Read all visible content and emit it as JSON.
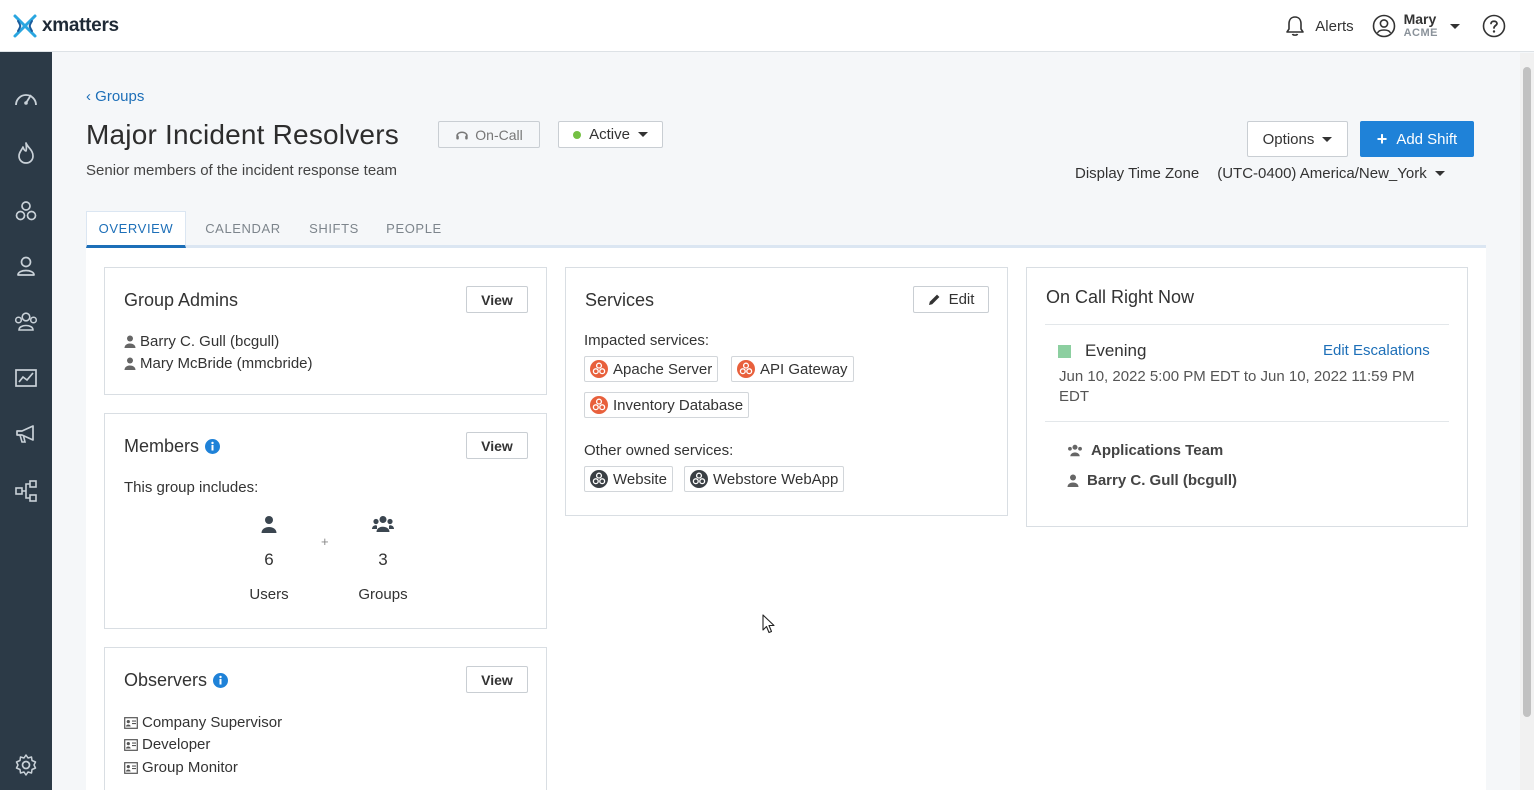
{
  "app": {
    "name": "xmatters"
  },
  "topbar": {
    "alerts_label": "Alerts",
    "user_name": "Mary",
    "user_org": "ACME"
  },
  "sidebar": {
    "items": [
      "dashboard-icon",
      "incidents-icon",
      "groups-icon",
      "users-icon",
      "teams-icon",
      "reports-icon",
      "messaging-icon",
      "workflows-icon",
      "settings-icon"
    ]
  },
  "header": {
    "breadcrumb": "Groups",
    "title": "Major Incident Resolvers",
    "oncall_label": "On-Call",
    "status_label": "Active",
    "subtitle": "Senior members of the incident response team",
    "options_label": "Options",
    "add_shift_label": "Add Shift",
    "timezone_label": "Display Time Zone",
    "timezone_value": "(UTC-0400) America/New_York"
  },
  "tabs": [
    {
      "label": "OVERVIEW",
      "active": true
    },
    {
      "label": "CALENDAR",
      "active": false
    },
    {
      "label": "SHIFTS",
      "active": false
    },
    {
      "label": "PEOPLE",
      "active": false
    }
  ],
  "group_admins": {
    "title": "Group Admins",
    "view_label": "View",
    "admins": [
      "Barry C. Gull (bcgull)",
      "Mary McBride (mmcbride)"
    ]
  },
  "members": {
    "title": "Members",
    "view_label": "View",
    "includes_label": "This group includes:",
    "users_count": "6",
    "users_label": "Users",
    "plus": "+",
    "groups_count": "3",
    "groups_label": "Groups"
  },
  "observers": {
    "title": "Observers",
    "view_label": "View",
    "roles": [
      "Company Supervisor",
      "Developer",
      "Group Monitor"
    ]
  },
  "services": {
    "title": "Services",
    "edit_label": "Edit",
    "impacted_label": "Impacted services:",
    "impacted": [
      "Apache Server",
      "API Gateway",
      "Inventory Database"
    ],
    "other_label": "Other owned services:",
    "other": [
      "Website",
      "Webstore WebApp"
    ]
  },
  "oncall_now": {
    "title": "On Call Right Now",
    "shift_name": "Evening",
    "edit_escalations": "Edit Escalations",
    "shift_time": "Jun 10, 2022 5:00 PM EDT to Jun 10, 2022 11:59 PM EDT",
    "members": [
      "Applications Team",
      "Barry C. Gull (bcgull)"
    ]
  },
  "colors": {
    "accent": "#1f82d8",
    "link": "#1d6fb8",
    "sidebar": "#2c3a47",
    "active_dot": "#74c043",
    "impacted_service": "#e8603c",
    "owned_service": "#3a3f44",
    "shift_color": "#8ccfa0"
  }
}
